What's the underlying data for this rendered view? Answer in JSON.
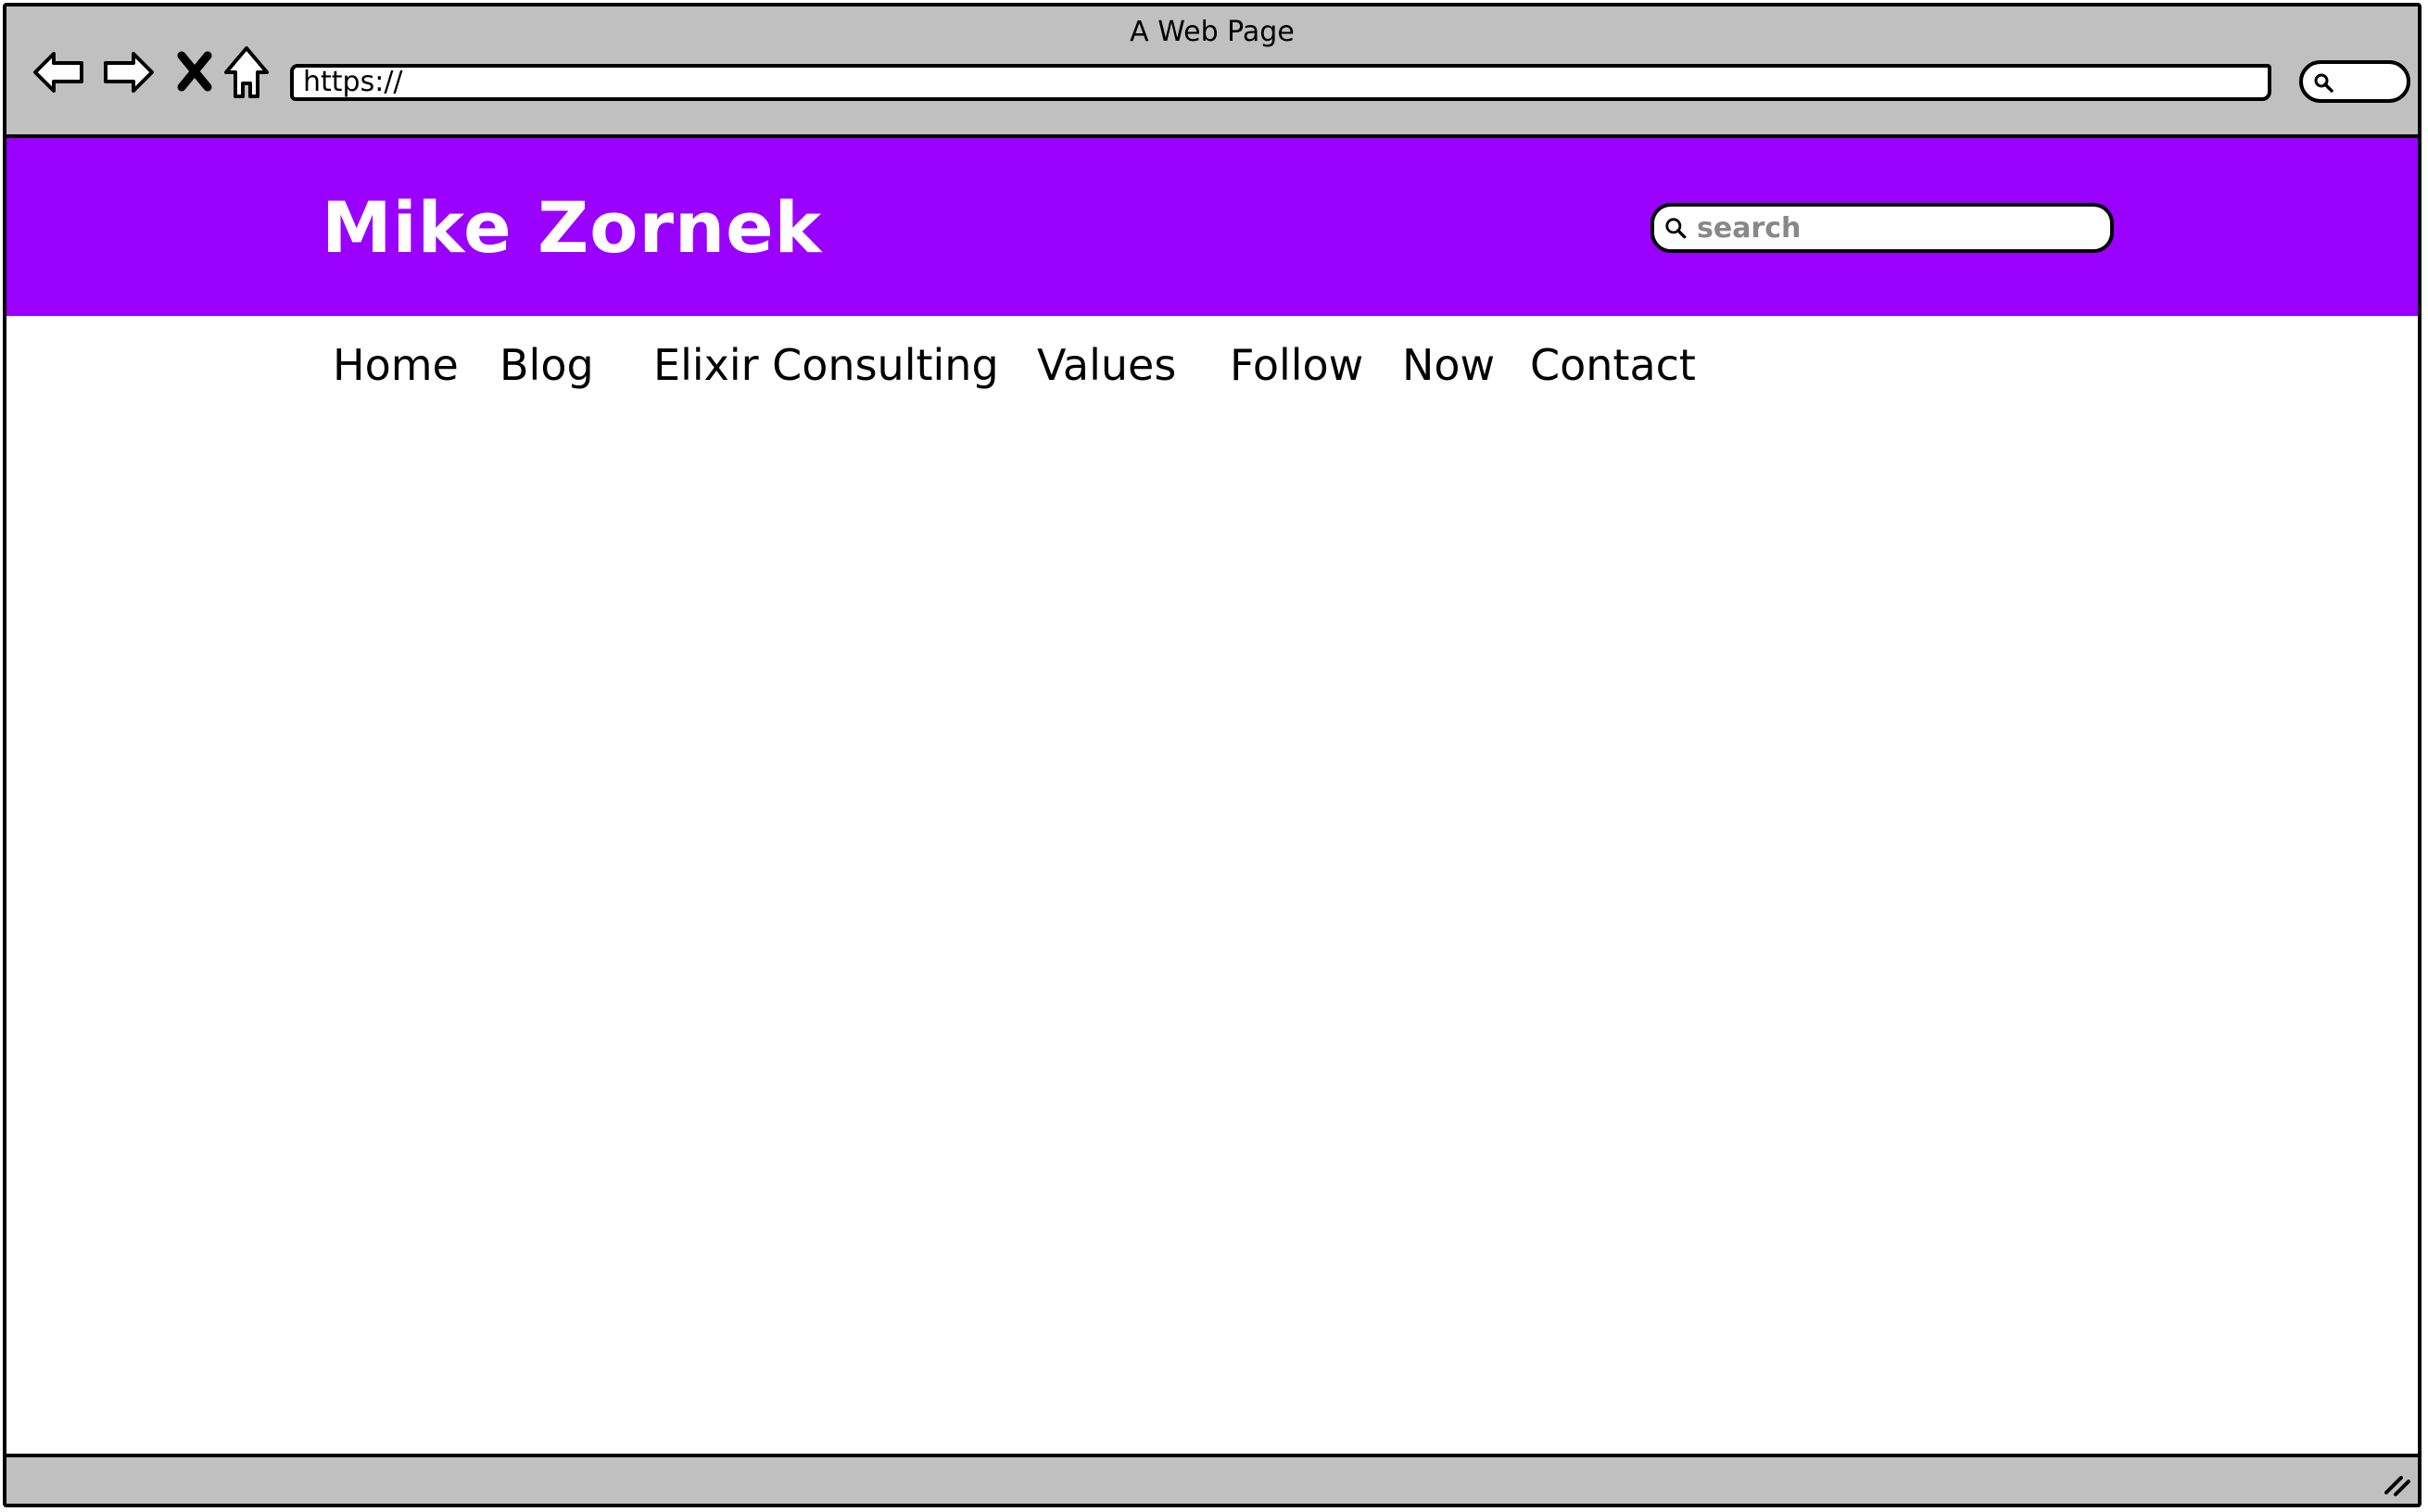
{
  "window": {
    "title": "A Web Page",
    "url": "https://"
  },
  "header": {
    "site_title": "Mike Zornek",
    "search_placeholder": "search",
    "background_color": "#9900ff"
  },
  "nav": {
    "items": [
      {
        "label": "Home"
      },
      {
        "label": "Blog"
      },
      {
        "label": "Elixir Consulting"
      },
      {
        "label": "Values"
      },
      {
        "label": "Follow"
      },
      {
        "label": "Now"
      },
      {
        "label": "Contact"
      }
    ]
  },
  "icons": {
    "back": "arrow-left-icon",
    "forward": "arrow-right-icon",
    "stop": "close-icon",
    "home": "home-icon",
    "search": "search-icon",
    "resize": "resize-grip-icon"
  }
}
